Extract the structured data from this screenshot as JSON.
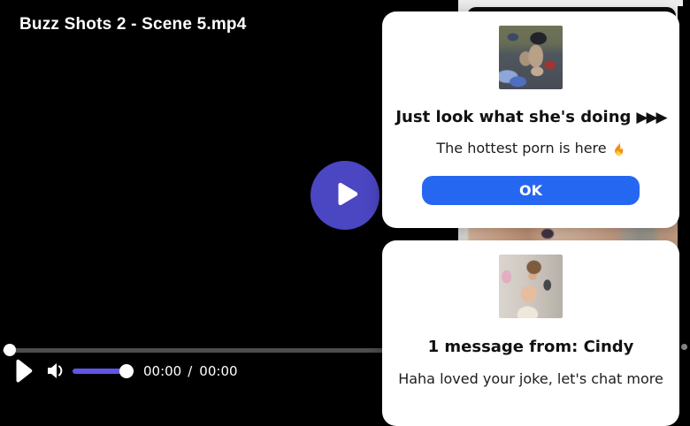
{
  "player": {
    "title": "Buzz Shots 2 - Scene 5.mp4",
    "current_time": "00:00",
    "time_separator": "/",
    "duration": "00:00",
    "colors": {
      "play_overlay": "#4b46c2",
      "volume_slider": "#6055e5",
      "seek_track": "#4d4d4d"
    }
  },
  "popups": [
    {
      "thumbnail": "webcam-couple-thumbnail",
      "title": "Just look what she's doing",
      "title_arrows": "▶▶▶",
      "subtitle": "The hottest porn is here",
      "subtitle_icon": "fire-icon",
      "button_label": "OK",
      "button_color": "#2667f2"
    },
    {
      "thumbnail": "selfie-girl-thumbnail",
      "title": "1 message from: Cindy",
      "message": "Haha loved your joke, let's chat more"
    }
  ]
}
